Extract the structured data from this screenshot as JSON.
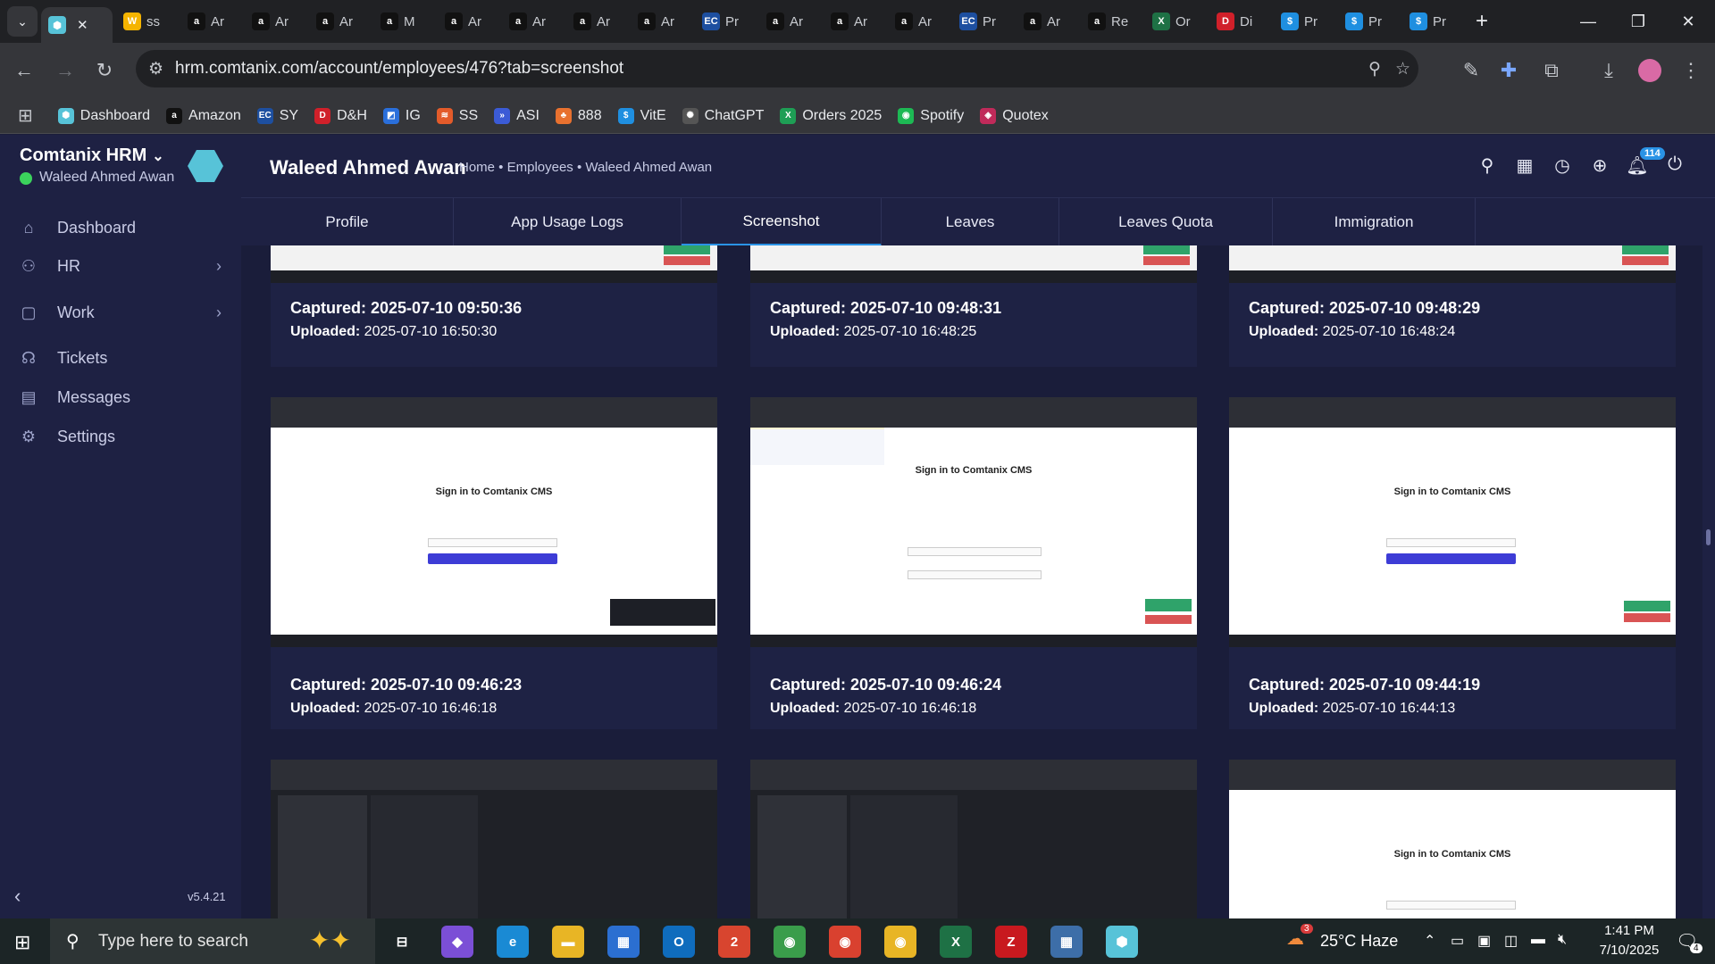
{
  "browser": {
    "tabs": [
      {
        "label": "",
        "icon": "comtanix-logo",
        "color": "#57c3d8",
        "active": true
      },
      {
        "label": "ss",
        "icon": "w-logo",
        "color": "#f5b400"
      },
      {
        "label": "Ar",
        "icon": "amazon-logo",
        "color": "#111111"
      },
      {
        "label": "Ar",
        "icon": "amazon-logo",
        "color": "#111111"
      },
      {
        "label": "Ar",
        "icon": "amazon-logo",
        "color": "#111111"
      },
      {
        "label": "M",
        "icon": "amazon-logo",
        "color": "#111111"
      },
      {
        "label": "Ar",
        "icon": "amazon-logo",
        "color": "#111111"
      },
      {
        "label": "Ar",
        "icon": "amazon-logo",
        "color": "#111111"
      },
      {
        "label": "Ar",
        "icon": "amazon-logo",
        "color": "#111111"
      },
      {
        "label": "Ar",
        "icon": "amazon-logo",
        "color": "#111111"
      },
      {
        "label": "Pr",
        "icon": "ec-logo",
        "color": "#1d4fa0"
      },
      {
        "label": "Ar",
        "icon": "amazon-logo",
        "color": "#111111"
      },
      {
        "label": "Ar",
        "icon": "amazon-logo",
        "color": "#111111"
      },
      {
        "label": "Ar",
        "icon": "amazon-logo",
        "color": "#111111"
      },
      {
        "label": "Pr",
        "icon": "ec-logo",
        "color": "#1d4fa0"
      },
      {
        "label": "Ar",
        "icon": "amazon-logo",
        "color": "#111111"
      },
      {
        "label": "Re",
        "icon": "amazon-logo",
        "color": "#111111"
      },
      {
        "label": "Or",
        "icon": "excel-logo",
        "color": "#1e7145"
      },
      {
        "label": "Di",
        "icon": "dh-logo",
        "color": "#d0202a"
      },
      {
        "label": "Pr",
        "icon": "dollar-logo",
        "color": "#1f8fe0"
      },
      {
        "label": "Pr",
        "icon": "dollar-logo",
        "color": "#1f8fe0"
      },
      {
        "label": "Pr",
        "icon": "dollar-logo",
        "color": "#1f8fe0"
      }
    ],
    "url": "hrm.comtanix.com/account/employees/476?tab=screenshot",
    "bookmarks": [
      {
        "label": "Dashboard",
        "icon": "hex-icon",
        "color": "#57c3d8"
      },
      {
        "label": "Amazon",
        "icon": "amazon-icon",
        "color": "#111111"
      },
      {
        "label": "SY",
        "icon": "ec-icon",
        "color": "#1d4fa0"
      },
      {
        "label": "D&H",
        "icon": "dh-icon",
        "color": "#d0202a"
      },
      {
        "label": "IG",
        "icon": "ig-icon",
        "color": "#2a6fdb"
      },
      {
        "label": "SS",
        "icon": "ss-icon",
        "color": "#e35b2a"
      },
      {
        "label": "ASI",
        "icon": "asi-icon",
        "color": "#3b5bd6"
      },
      {
        "label": "888",
        "icon": "888-icon",
        "color": "#e8712f"
      },
      {
        "label": "VitE",
        "icon": "dollar-icon",
        "color": "#1f8fe0"
      },
      {
        "label": "ChatGPT",
        "icon": "chatgpt-icon",
        "color": "#555555"
      },
      {
        "label": "Orders 2025",
        "icon": "sheets-icon",
        "color": "#1e9e55"
      },
      {
        "label": "Spotify",
        "icon": "spotify-icon",
        "color": "#1db954"
      },
      {
        "label": "Quotex",
        "icon": "quotex-icon",
        "color": "#c02a5a"
      }
    ]
  },
  "app": {
    "brand": "Comtanix HRM",
    "user": "Waleed Ahmed Awan",
    "nav": [
      {
        "label": "Dashboard",
        "icon": "home-icon",
        "arrow": false
      },
      {
        "label": "HR",
        "icon": "users-icon",
        "arrow": true
      },
      {
        "label": "Work",
        "icon": "briefcase-icon",
        "arrow": true
      },
      {
        "label": "Tickets",
        "icon": "headset-icon",
        "arrow": false
      },
      {
        "label": "Messages",
        "icon": "message-icon",
        "arrow": false
      },
      {
        "label": "Settings",
        "icon": "gear-icon",
        "arrow": false
      }
    ],
    "version": "v5.4.21",
    "page_title": "Waleed Ahmed Awan",
    "breadcrumb": "Home • Employees • Waleed Ahmed Awan",
    "notification_count": "114",
    "tabs": [
      "Profile",
      "App Usage Logs",
      "Screenshot",
      "Leaves",
      "Leaves Quota",
      "Immigration"
    ],
    "active_tab": "Screenshot",
    "screenshots": [
      {
        "captured_label": "Captured:",
        "captured": "2025-07-10 09:50:36",
        "uploaded_label": "Uploaded:",
        "uploaded": "2025-07-10 16:50:30",
        "kind": "partial"
      },
      {
        "captured_label": "Captured:",
        "captured": "2025-07-10 09:48:31",
        "uploaded_label": "Uploaded:",
        "uploaded": "2025-07-10 16:48:25",
        "kind": "partial"
      },
      {
        "captured_label": "Captured:",
        "captured": "2025-07-10 09:48:29",
        "uploaded_label": "Uploaded:",
        "uploaded": "2025-07-10 16:48:24",
        "kind": "partial"
      },
      {
        "captured_label": "Captured:",
        "captured": "2025-07-10 09:46:23",
        "uploaded_label": "Uploaded:",
        "uploaded": "2025-07-10 16:46:18",
        "kind": "signin",
        "mini_title": "Sign in to Comtanix CMS"
      },
      {
        "captured_label": "Captured:",
        "captured": "2025-07-10 09:46:24",
        "uploaded_label": "Uploaded:",
        "uploaded": "2025-07-10 16:46:18",
        "kind": "password",
        "mini_title": "Sign in to Comtanix CMS"
      },
      {
        "captured_label": "Captured:",
        "captured": "2025-07-10 09:44:19",
        "uploaded_label": "Uploaded:",
        "uploaded": "2025-07-10 16:44:13",
        "kind": "signin",
        "mini_title": "Sign in to Comtanix CMS"
      },
      {
        "kind": "chat"
      },
      {
        "kind": "chat"
      },
      {
        "kind": "signin",
        "mini_title": "Sign in to Comtanix CMS"
      }
    ]
  },
  "taskbar": {
    "search_placeholder": "Type here to search",
    "weather": "25°C  Haze",
    "weather_alert": "3",
    "time": "1:41 PM",
    "date": "7/10/2025",
    "notifications": "4",
    "apps": [
      {
        "name": "task-view-icon",
        "color": "transparent",
        "glyph": "⊟"
      },
      {
        "name": "copilot-icon",
        "color": "#7b4fd6",
        "glyph": "◆"
      },
      {
        "name": "edge-icon",
        "color": "#1a8ad4",
        "glyph": "e"
      },
      {
        "name": "file-explorer-icon",
        "color": "#e8b525",
        "glyph": "▬"
      },
      {
        "name": "store-icon",
        "color": "#2b6fd1",
        "glyph": "▦"
      },
      {
        "name": "outlook-icon",
        "color": "#0f6cbd",
        "glyph": "O"
      },
      {
        "name": "calendar-app-icon",
        "color": "#d8452f",
        "glyph": "2"
      },
      {
        "name": "chrome-icon",
        "color": "#3a9d4b",
        "glyph": "◉"
      },
      {
        "name": "chrome-icon-2",
        "color": "#d9412f",
        "glyph": "◉"
      },
      {
        "name": "chrome-icon-3",
        "color": "#e8b525",
        "glyph": "◉"
      },
      {
        "name": "excel-icon",
        "color": "#1e7145",
        "glyph": "X"
      },
      {
        "name": "filezilla-icon",
        "color": "#c8191f",
        "glyph": "Z"
      },
      {
        "name": "calculator-icon",
        "color": "#3d6ea8",
        "glyph": "▦"
      },
      {
        "name": "comtanix-app-icon",
        "color": "#57c3d8",
        "glyph": "⬢"
      }
    ]
  }
}
